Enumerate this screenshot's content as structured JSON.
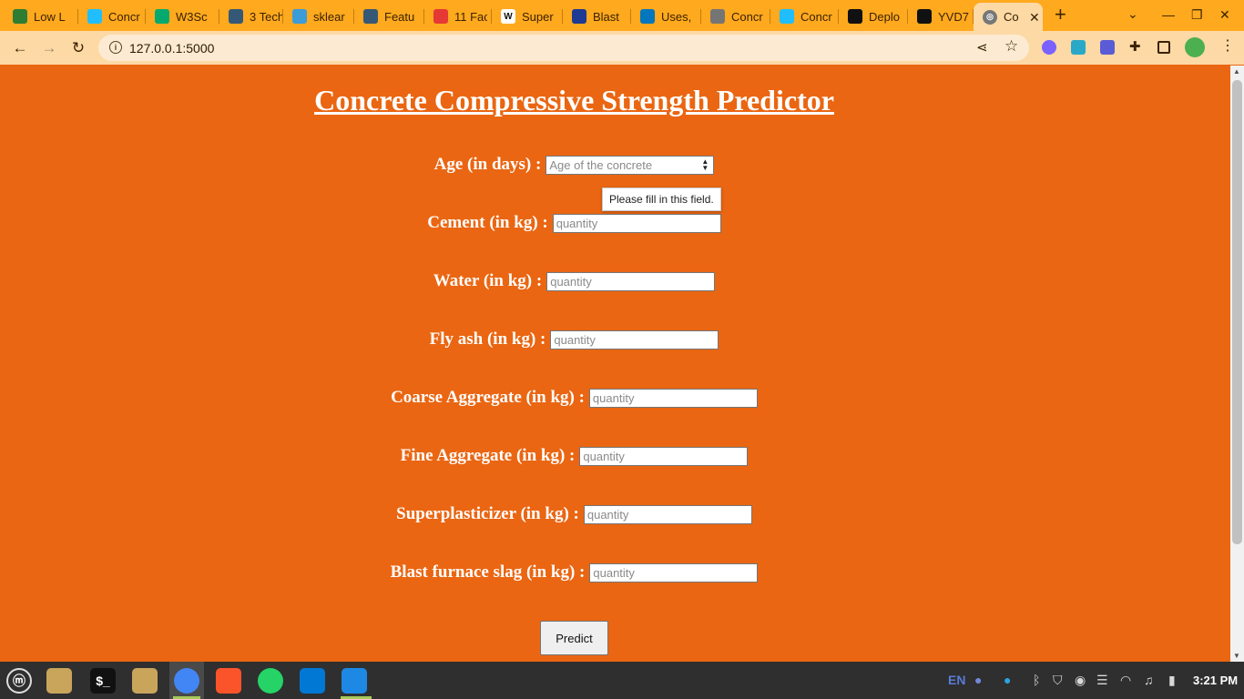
{
  "browser": {
    "tabs": [
      {
        "title": "Low L",
        "favicon": "lowcode-icon",
        "color": "#2e7d32"
      },
      {
        "title": "Concr",
        "favicon": "kaggle-icon",
        "color": "#20beff"
      },
      {
        "title": "W3Sc",
        "favicon": "w3schools-icon",
        "color": "#04aa6d"
      },
      {
        "title": "3 Tech",
        "favicon": "tds-icon",
        "color": "#355876"
      },
      {
        "title": "sklear",
        "favicon": "sklearn-icon",
        "color": "#3b9cd7"
      },
      {
        "title": "Featu",
        "favicon": "tds-icon",
        "color": "#355876"
      },
      {
        "title": "11 Fac",
        "favicon": "analytics-icon",
        "color": "#e53935"
      },
      {
        "title": "Super",
        "favicon": "wikipedia-icon",
        "color": "#ffffff"
      },
      {
        "title": "Blast",
        "favicon": "blast-icon",
        "color": "#1f3a93"
      },
      {
        "title": "Uses,",
        "favicon": "home-icon",
        "color": "#0277bd"
      },
      {
        "title": "Concr",
        "favicon": "globe-icon",
        "color": "#757575"
      },
      {
        "title": "Concr",
        "favicon": "kaggle-icon",
        "color": "#20beff"
      },
      {
        "title": "Deplo",
        "favicon": "github-icon",
        "color": "#111111"
      },
      {
        "title": "YVD7",
        "favicon": "github-icon",
        "color": "#111111"
      }
    ],
    "active_tab": {
      "title": "Co",
      "favicon": "globe-icon"
    },
    "address": "127.0.0.1:5000",
    "tabstrip_color": "#ffa91e",
    "toolbar_color": "#fdd9a5"
  },
  "page": {
    "title": "Concrete Compressive Strength Predictor",
    "background": "#ea6612",
    "age": {
      "label": "Age (in days) :",
      "placeholder": "Age of the concrete"
    },
    "tooltip": "Please fill in this field.",
    "fields": [
      {
        "name": "cement",
        "label": "Cement (in kg) :",
        "placeholder": "quantity"
      },
      {
        "name": "water",
        "label": "Water (in kg) :",
        "placeholder": "quantity"
      },
      {
        "name": "fly-ash",
        "label": "Fly ash (in kg) :",
        "placeholder": "quantity"
      },
      {
        "name": "coarse-aggregate",
        "label": "Coarse Aggregate (in kg) :",
        "placeholder": "quantity"
      },
      {
        "name": "fine-aggregate",
        "label": "Fine Aggregate (in kg) :",
        "placeholder": "quantity"
      },
      {
        "name": "superplasticizer",
        "label": "Superplasticizer (in kg) :",
        "placeholder": "quantity"
      },
      {
        "name": "blast-furnace-slag",
        "label": "Blast furnace slag (in kg) :",
        "placeholder": "quantity"
      }
    ],
    "predict_label": "Predict"
  },
  "taskbar": {
    "apps": [
      {
        "name": "menu-icon",
        "glyph": "ⓜ",
        "color": "#2f2f2f"
      },
      {
        "name": "files-icon",
        "glyph": "",
        "color": "#c9a55c"
      },
      {
        "name": "terminal-icon",
        "glyph": "$_",
        "color": "#111111"
      },
      {
        "name": "folder-icon",
        "glyph": "",
        "color": "#c9a55c"
      },
      {
        "name": "chrome-icon",
        "glyph": "",
        "color": "#4285f4"
      },
      {
        "name": "brave-icon",
        "glyph": "",
        "color": "#fb542b"
      },
      {
        "name": "whatsapp-icon",
        "glyph": "",
        "color": "#25d366"
      },
      {
        "name": "vscode-icon",
        "glyph": "",
        "color": "#0078d4"
      },
      {
        "name": "text-editor-icon",
        "glyph": "",
        "color": "#1e88e5"
      }
    ],
    "language": "EN",
    "clock": "3:21 PM"
  }
}
